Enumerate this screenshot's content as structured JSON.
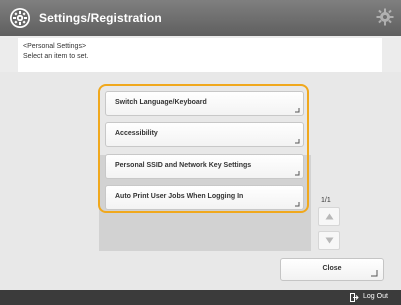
{
  "header": {
    "title": "Settings/Registration",
    "app_icon": "settings-registration-icon",
    "right_icon": "gear-icon"
  },
  "instruction_panel": {
    "breadcrumb": "<Personal Settings>",
    "instruction": "Select an item to set."
  },
  "menu": {
    "items": [
      {
        "label": "Switch Language/Keyboard"
      },
      {
        "label": "Accessibility"
      },
      {
        "label": "Personal SSID and Network Key Settings"
      },
      {
        "label": "Auto Print User Jobs When Logging In"
      }
    ]
  },
  "pager": {
    "indicator": "1/1",
    "up_icon": "scroll-up-icon",
    "down_icon": "scroll-down-icon"
  },
  "close_button": {
    "label": "Close"
  },
  "footer": {
    "logout_label": "Log Out",
    "logout_icon": "logout-icon"
  },
  "colors": {
    "header_bg": "#6f6f6f",
    "highlight": "#f0a81d",
    "footer_bg": "#3b3b3b",
    "list_area_bg": "#d2d2d2"
  }
}
